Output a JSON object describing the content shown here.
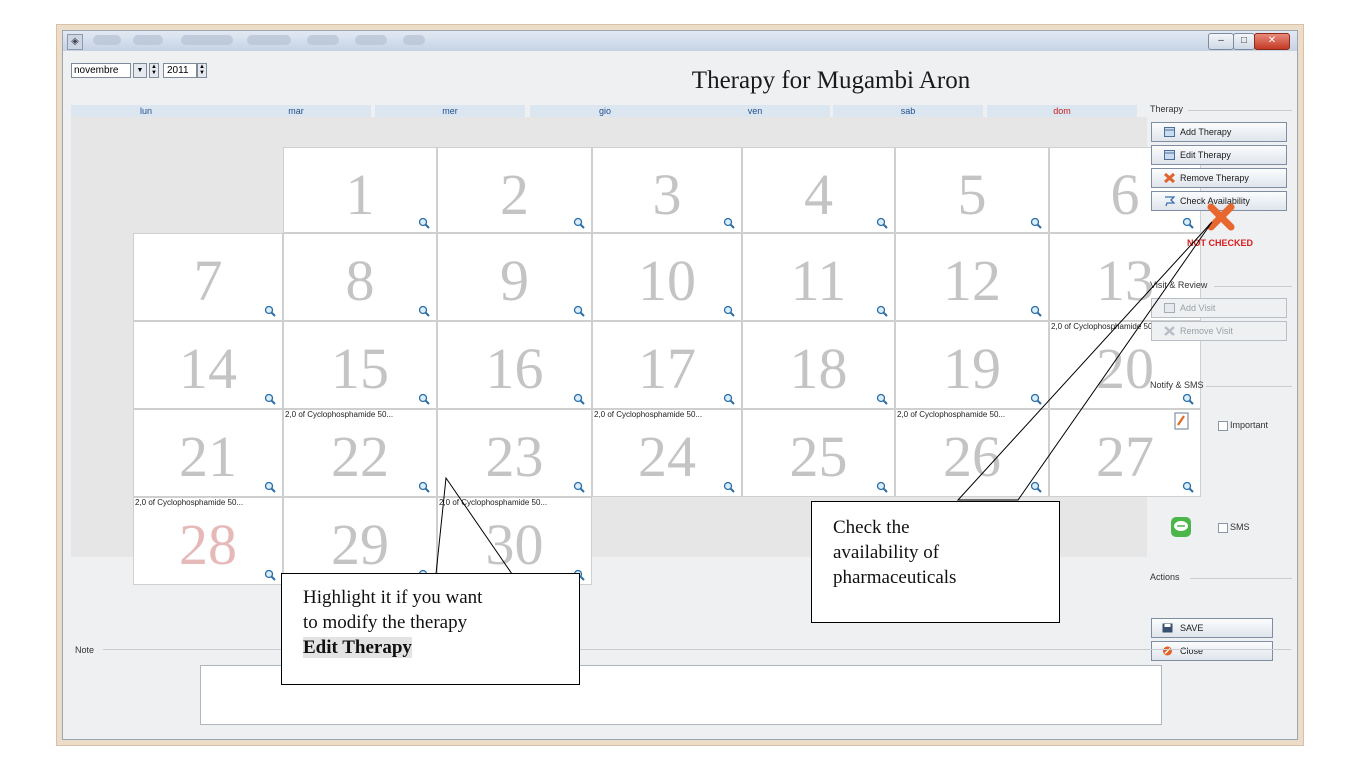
{
  "window": {
    "min_glyph": "–",
    "max_glyph": "□",
    "close_glyph": "✕"
  },
  "toolbar": {
    "month": "novembre",
    "year": "2011"
  },
  "calendar": {
    "title": "Therapy for Mugambi Aron",
    "weekdays": [
      "lun",
      "mar",
      "mer",
      "gio",
      "ven",
      "sab",
      "dom"
    ],
    "days": [
      {
        "day": "1"
      },
      {
        "day": "2"
      },
      {
        "day": "3"
      },
      {
        "day": "4"
      },
      {
        "day": "5"
      },
      {
        "day": "6"
      },
      {
        "day": "7"
      },
      {
        "day": "8"
      },
      {
        "day": "9"
      },
      {
        "day": "10"
      },
      {
        "day": "11"
      },
      {
        "day": "12"
      },
      {
        "day": "13"
      },
      {
        "day": "14"
      },
      {
        "day": "15"
      },
      {
        "day": "16"
      },
      {
        "day": "17"
      },
      {
        "day": "18"
      },
      {
        "day": "19"
      },
      {
        "day": "20",
        "event": "2,0 of Cyclophosphamide 50..."
      },
      {
        "day": "21"
      },
      {
        "day": "22",
        "event": "2,0 of Cyclophosphamide 50..."
      },
      {
        "day": "23"
      },
      {
        "day": "24",
        "event": "2,0 of Cyclophosphamide 50..."
      },
      {
        "day": "25"
      },
      {
        "day": "26",
        "event": "2,0 of Cyclophosphamide 50..."
      },
      {
        "day": "27"
      },
      {
        "day": "28",
        "event": "2,0 of Cyclophosphamide 50..."
      },
      {
        "day": "29"
      },
      {
        "day": "30",
        "event": "2,0 of Cyclophosphamide 50..."
      }
    ]
  },
  "sidebar": {
    "therapy_group": "Therapy",
    "add_therapy": "Add Therapy",
    "edit_therapy": "Edit Therapy",
    "remove_therapy": "Remove Therapy",
    "check_availability": "Check Availability",
    "status": "NOT CHECKED",
    "visit_group": "Visit & Review",
    "add_visit": "Add Visit",
    "remove_visit": "Remove Visit",
    "notify_group": "Notify & SMS",
    "important_label": "Important",
    "sms_label": "SMS",
    "actions_group": "Actions",
    "save": "SAVE",
    "close": "Close"
  },
  "note": {
    "label": "Note",
    "value": ""
  },
  "callouts": {
    "edit_line1": "Highlight it if you want",
    "edit_line2": "to modify the therapy",
    "edit_action": "Edit Therapy",
    "check_line1": "Check the",
    "check_line2": "availability of",
    "check_line3": "pharmaceuticals"
  },
  "colors": {
    "weekday_text": "#23508c",
    "sunday_text": "#c41d1d",
    "status_red": "#d81e1e",
    "day_number": "#c4c4c4"
  }
}
